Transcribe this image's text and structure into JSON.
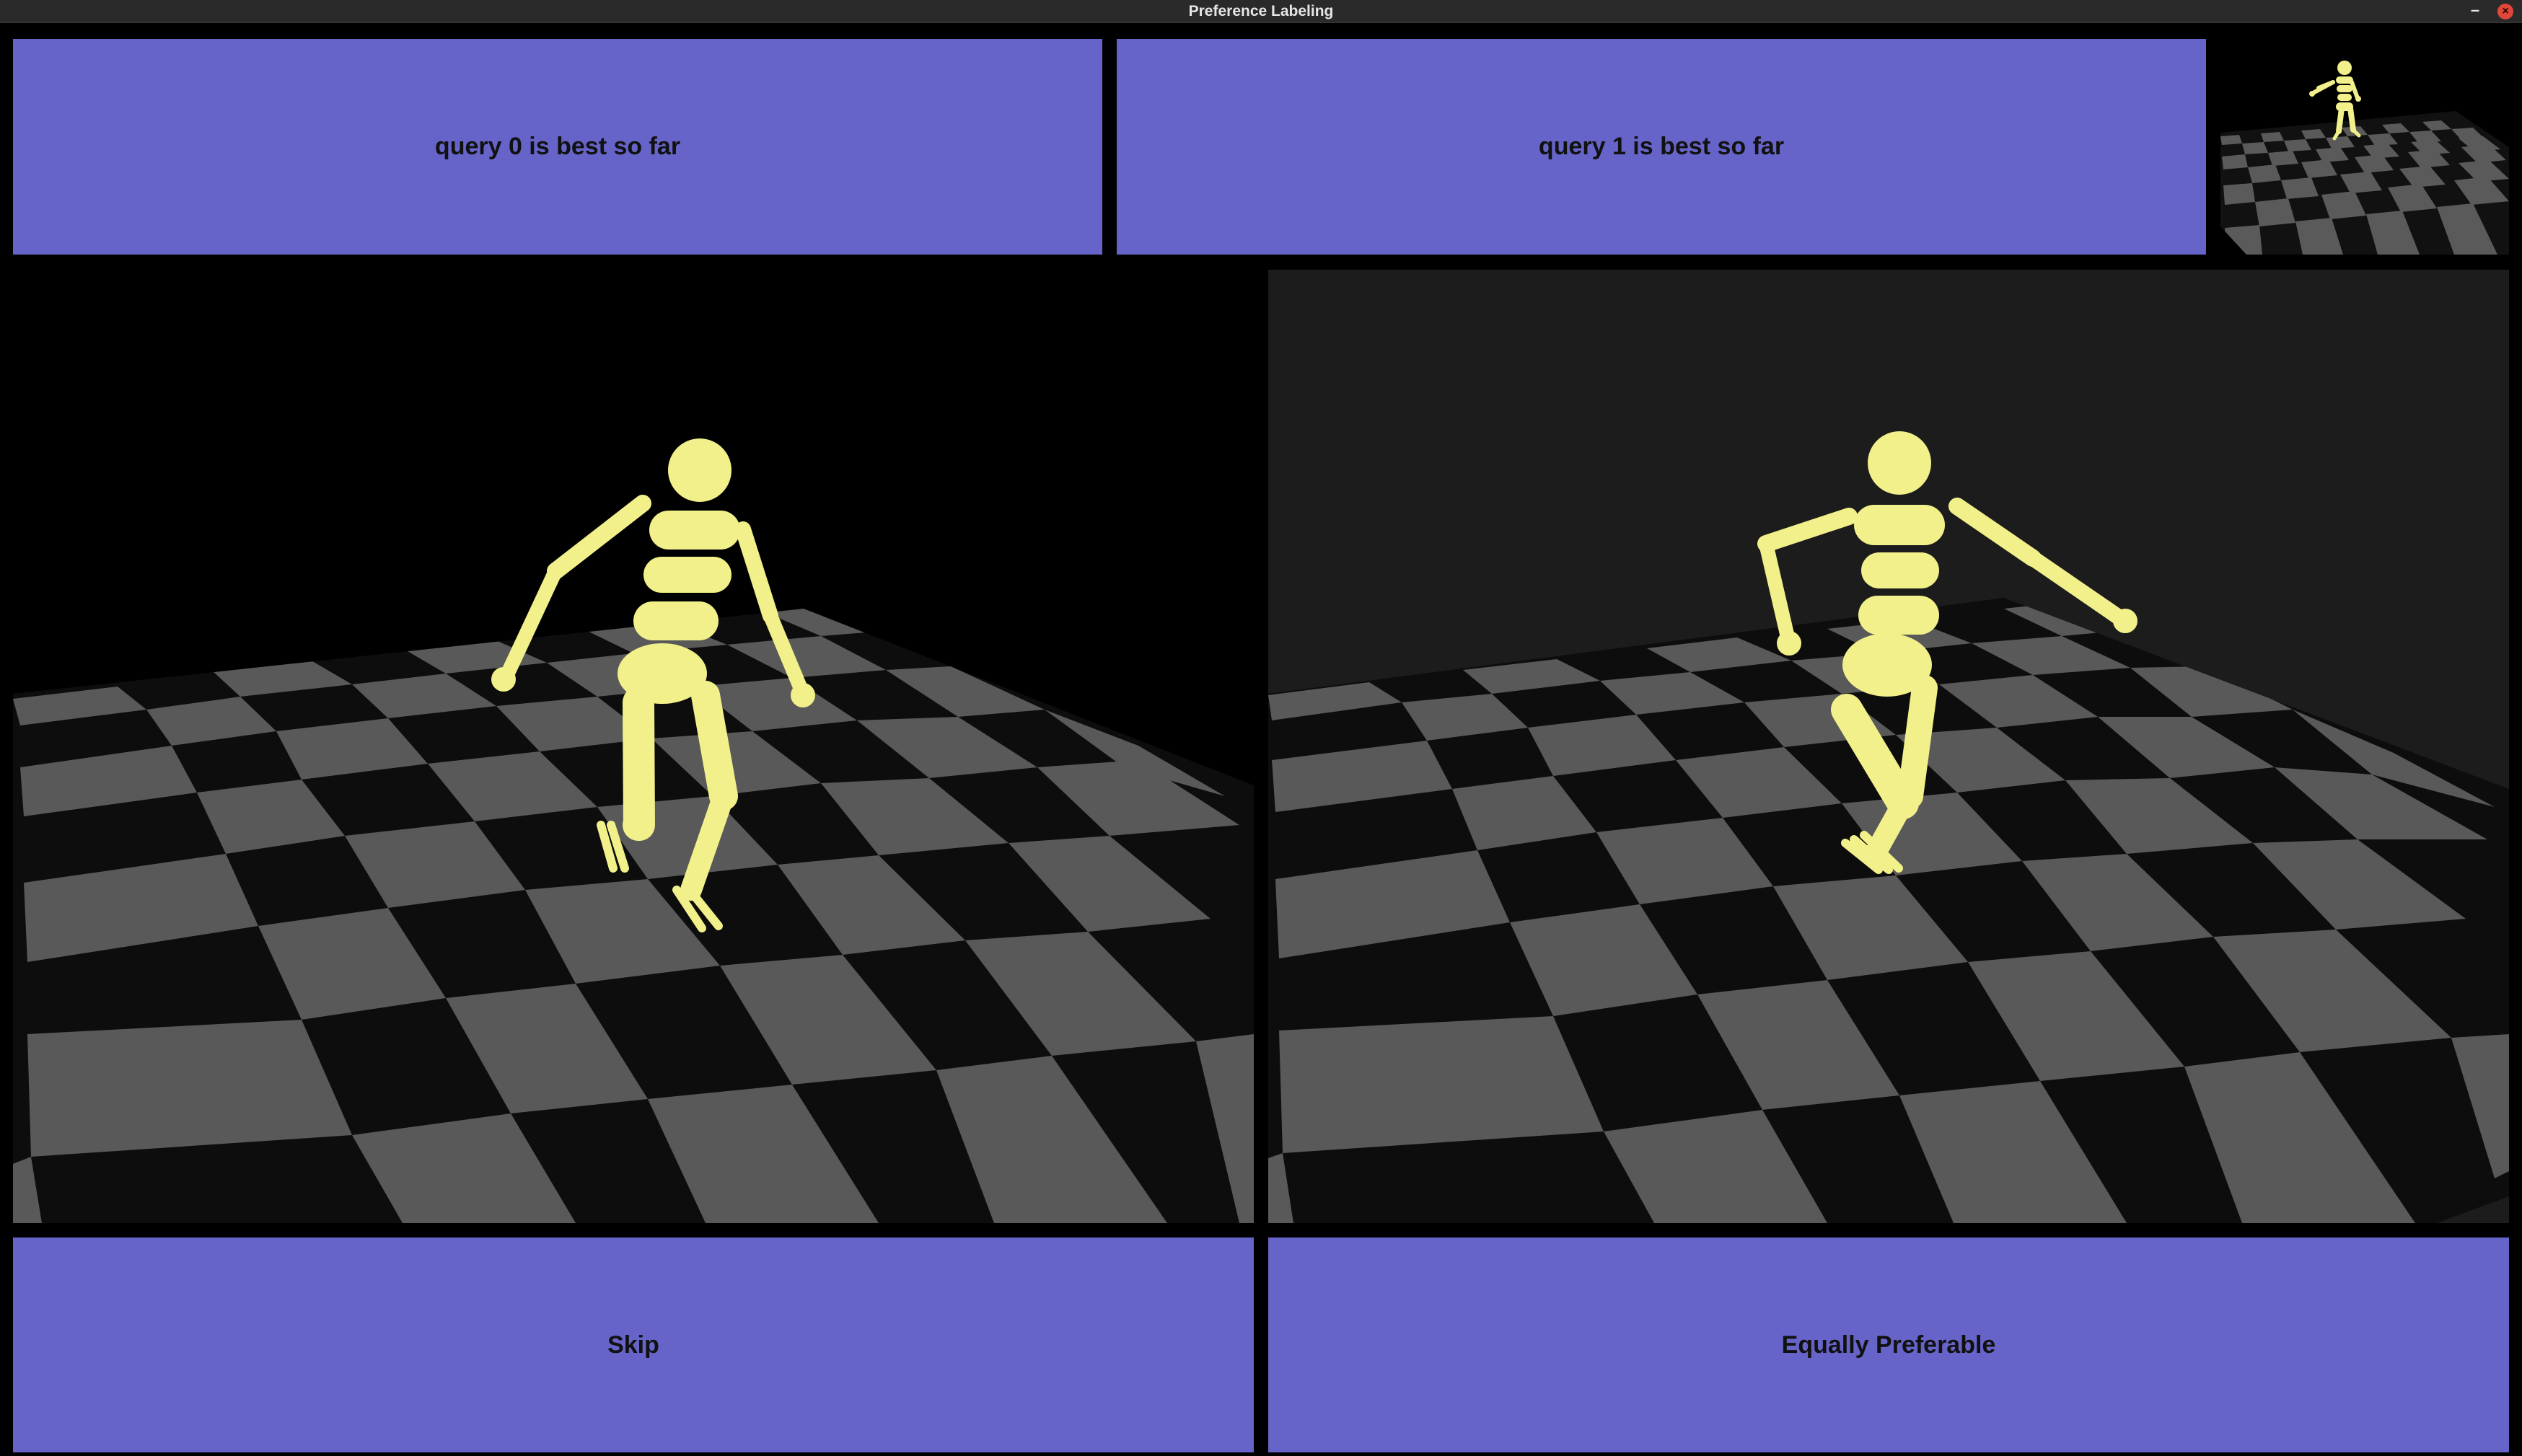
{
  "window": {
    "title": "Preference Labeling",
    "minimize_glyph": "–",
    "close_glyph": "×"
  },
  "buttons": {
    "query0": "query 0 is best so far",
    "query1": "query 1 is best so far",
    "skip": "Skip",
    "equal": "Equally Preferable"
  },
  "colors": {
    "button_bg": "#6664c8",
    "button_text": "#111111",
    "figure": "#f2f08a",
    "floor_light": "#595959",
    "floor_dark": "#0d0d0d",
    "background_left": "#000000",
    "background_right": "#1c1c1c"
  },
  "icons": {
    "minimize": "minimize-icon",
    "close": "close-icon"
  }
}
